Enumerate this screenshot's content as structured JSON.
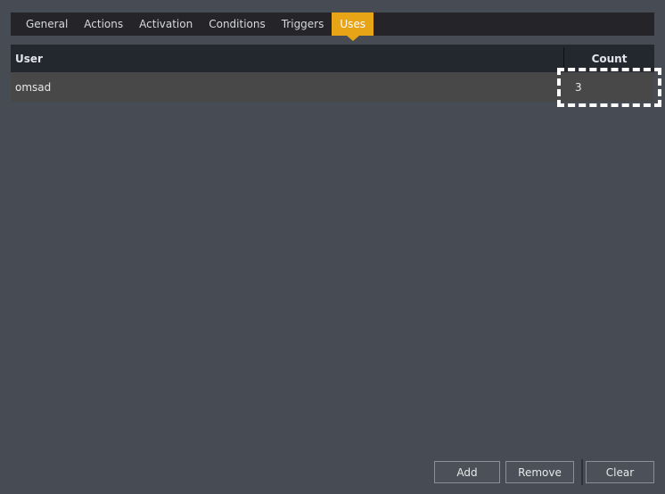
{
  "colors": {
    "window_background": "#474b54",
    "tabbar_background": "#252529",
    "active_tab": "#e8a417",
    "table_header": "#23272e",
    "table_row": "#484848",
    "focus_outline": "#ffffff",
    "button_face": "#4c5058",
    "button_border": "#8b9097",
    "text": "#e6e8ea"
  },
  "tabs": [
    {
      "label": "General",
      "active": false
    },
    {
      "label": "Actions",
      "active": false
    },
    {
      "label": "Activation",
      "active": false
    },
    {
      "label": "Conditions",
      "active": false
    },
    {
      "label": "Triggers",
      "active": false
    },
    {
      "label": "Uses",
      "active": true
    }
  ],
  "table": {
    "columns": [
      {
        "key": "user",
        "label": "User",
        "align": "left"
      },
      {
        "key": "count",
        "label": "Count",
        "align": "center"
      }
    ],
    "rows": [
      {
        "user": "omsad",
        "count": "3"
      }
    ]
  },
  "buttons": {
    "add": "Add",
    "remove": "Remove",
    "clear": "Clear"
  }
}
